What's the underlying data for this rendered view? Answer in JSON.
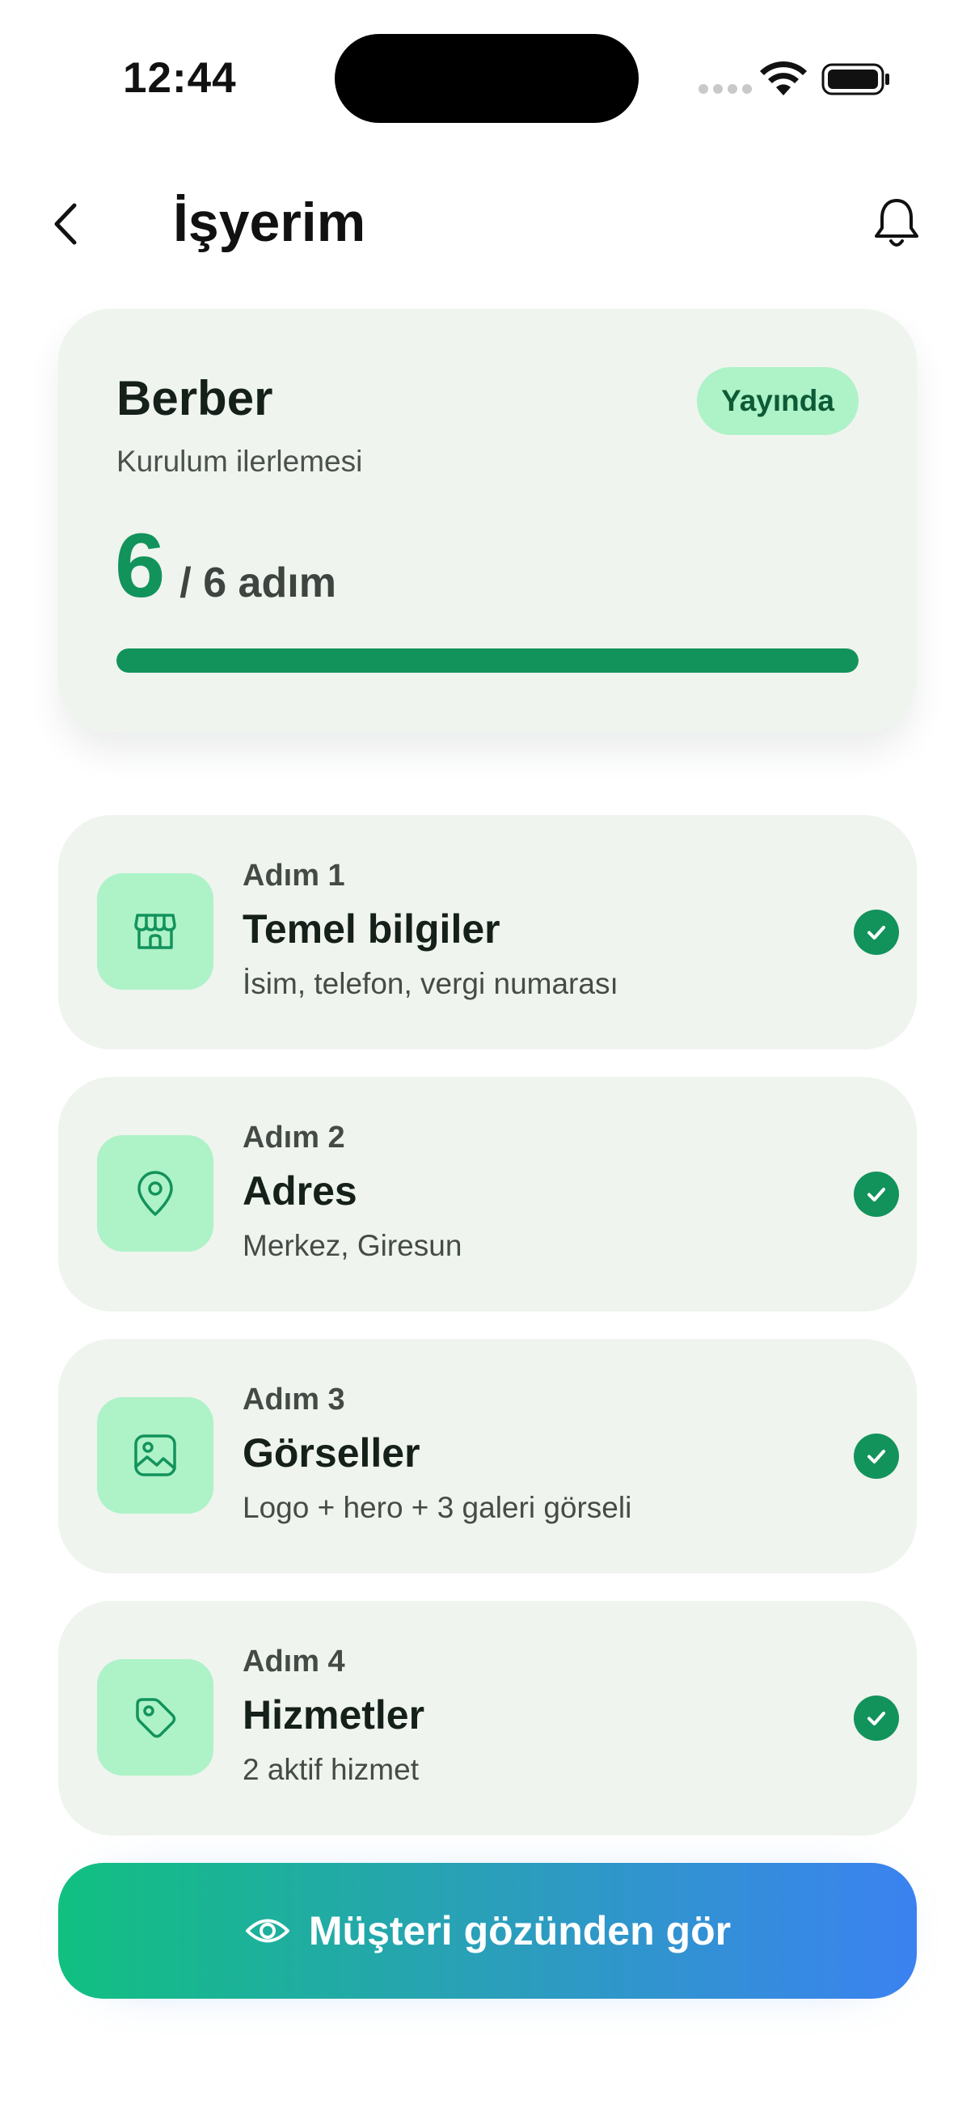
{
  "status_bar": {
    "time": "12:44"
  },
  "header": {
    "title": "İşyerim"
  },
  "progress_card": {
    "business_name": "Berber",
    "status_badge": "Yayında",
    "label": "Kurulum ilerlemesi",
    "steps_done": "6",
    "steps_total_text": "/ 6 adım",
    "progress_fraction": 1.0
  },
  "steps": [
    {
      "number": "Adım 1",
      "title": "Temel bilgiler",
      "description": "İsim, telefon, vergi numarası",
      "icon": "storefront-icon",
      "completed": true
    },
    {
      "number": "Adım 2",
      "title": "Adres",
      "description": "Merkez, Giresun",
      "icon": "location-pin-icon",
      "completed": true
    },
    {
      "number": "Adım 3",
      "title": "Görseller",
      "description": "Logo + hero + 3 galeri görseli",
      "icon": "image-icon",
      "completed": true
    },
    {
      "number": "Adım 4",
      "title": "Hizmetler",
      "description": "2 aktif hizmet",
      "icon": "tag-icon",
      "completed": true
    }
  ],
  "cta": {
    "label": "Müşteri gözünden gör",
    "icon": "eye-icon"
  },
  "colors": {
    "accent_green": "#12935b",
    "badge_bg": "#aef2c8",
    "card_bg": "#eff4ee",
    "cta_gradient_start": "#11c080",
    "cta_gradient_end": "#3b82f1"
  }
}
